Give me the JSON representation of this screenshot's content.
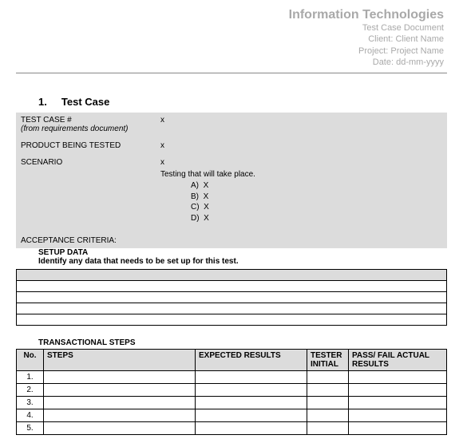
{
  "header": {
    "org": "Information Technologies",
    "doc": "Test Case Document",
    "client": "Client:  Client Name",
    "project": "Project: Project Name",
    "date": "Date: dd-mm-yyyy"
  },
  "section": {
    "number": "1.",
    "title": "Test Case"
  },
  "greybox": {
    "testCaseLabel": "TEST CASE #",
    "testCaseNote": "(from requirements  document)",
    "testCaseValue": "x",
    "productLabel": "PRODUCT BEING TESTED",
    "productValue": "x",
    "scenarioLabel": "SCENARIO",
    "scenarioValue": "x",
    "testingLine": "Testing that will take place.",
    "options": [
      {
        "k": "A)",
        "v": "X"
      },
      {
        "k": "B)",
        "v": "X"
      },
      {
        "k": "C)",
        "v": "X"
      },
      {
        "k": "D)",
        "v": "X"
      }
    ],
    "acceptanceLabel": "ACCEPTANCE CRITERIA:"
  },
  "setup": {
    "heading": "SETUP DATA",
    "desc": "Identify any data that needs to be set up for this test."
  },
  "steps": {
    "heading": "TRANSACTIONAL STEPS",
    "cols": {
      "no": "No.",
      "steps": "STEPS",
      "expected": "EXPECTED RESULTS",
      "tester": "TESTER INITIAL",
      "result": "PASS/ FAIL ACTUAL RESULTS"
    },
    "rows": [
      "1.",
      "2.",
      "3.",
      "4.",
      "5."
    ]
  }
}
